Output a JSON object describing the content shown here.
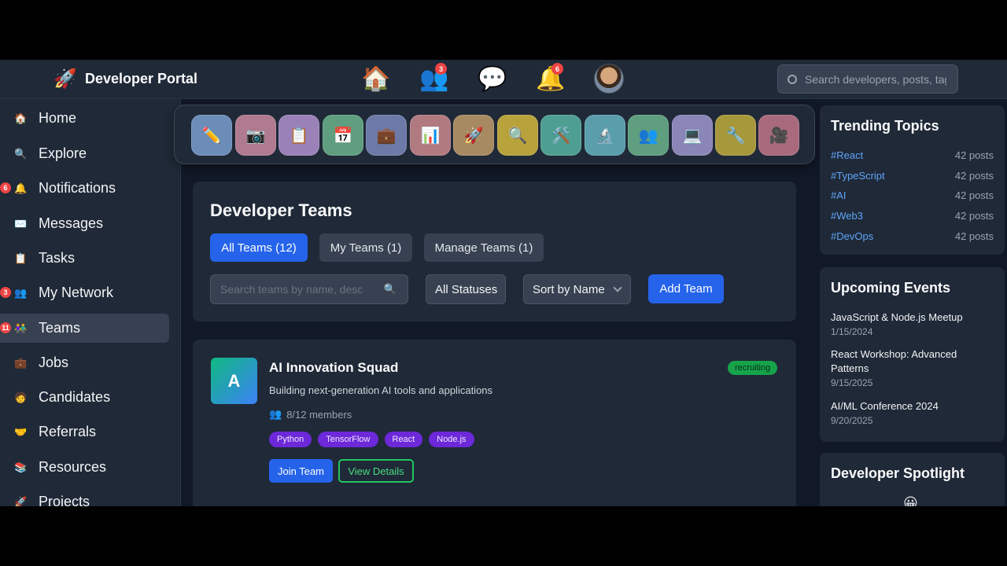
{
  "brand": {
    "name": "Developer Portal",
    "logo_icon": "🚀"
  },
  "topnav": {
    "icons": [
      {
        "name": "home-icon",
        "glyph": "🏠",
        "badge": ""
      },
      {
        "name": "network-icon",
        "glyph": "👥",
        "badge": "3"
      },
      {
        "name": "messages-icon",
        "glyph": "💬",
        "badge": ""
      },
      {
        "name": "notifications-icon",
        "glyph": "🔔",
        "badge": "6"
      }
    ],
    "search_placeholder": "Search developers, posts, tags..."
  },
  "sidebar": {
    "items": [
      {
        "label": "Home",
        "icon": "🏠",
        "badge": ""
      },
      {
        "label": "Explore",
        "icon": "🔍",
        "badge": ""
      },
      {
        "label": "Notifications",
        "icon": "🔔",
        "badge": "6"
      },
      {
        "label": "Messages",
        "icon": "✉️",
        "badge": ""
      },
      {
        "label": "Tasks",
        "icon": "📋",
        "badge": ""
      },
      {
        "label": "My Network",
        "icon": "👥",
        "badge": "3"
      },
      {
        "label": "Teams",
        "icon": "👫",
        "badge": "11"
      },
      {
        "label": "Jobs",
        "icon": "💼",
        "badge": ""
      },
      {
        "label": "Candidates",
        "icon": "🧑",
        "badge": ""
      },
      {
        "label": "Referrals",
        "icon": "🤝",
        "badge": ""
      },
      {
        "label": "Resources",
        "icon": "📚",
        "badge": ""
      },
      {
        "label": "Projects",
        "icon": "🚀",
        "badge": ""
      }
    ],
    "active_index": 6
  },
  "quickbar": [
    {
      "icon": "✏️",
      "color": "#6b8db8"
    },
    {
      "icon": "📷",
      "color": "#b07a8f"
    },
    {
      "icon": "📋",
      "color": "#9a82b8"
    },
    {
      "icon": "📅",
      "color": "#5f9e7f"
    },
    {
      "icon": "💼",
      "color": "#6d7aa8"
    },
    {
      "icon": "📊",
      "color": "#b07a80"
    },
    {
      "icon": "🚀",
      "color": "#a88a62"
    },
    {
      "icon": "🔍",
      "color": "#b8a23c"
    },
    {
      "icon": "🛠️",
      "color": "#4f9e92"
    },
    {
      "icon": "🔬",
      "color": "#5a9eac"
    },
    {
      "icon": "👥",
      "color": "#5f9e7f"
    },
    {
      "icon": "💻",
      "color": "#8a86b8"
    },
    {
      "icon": "🔧",
      "color": "#a8983c"
    },
    {
      "icon": "🎥",
      "color": "#a86a7c"
    }
  ],
  "teams": {
    "title": "Developer Teams",
    "tabs": [
      "All Teams (12)",
      "My Teams (1)",
      "Manage Teams (1)"
    ],
    "search_placeholder": "Search teams by name, description...",
    "status_filter": "All Statuses",
    "sort": "Sort by Name",
    "add_label": "Add Team"
  },
  "team_card": {
    "initial": "A",
    "name": "AI Innovation Squad",
    "description": "Building next-generation AI tools and applications",
    "members": "8/12 members",
    "status": "recruiting",
    "tags": [
      "Python",
      "TensorFlow",
      "React",
      "Node.js"
    ],
    "join_label": "Join Team",
    "details_label": "View Details"
  },
  "trending": {
    "title": "Trending Topics",
    "topics": [
      {
        "tag": "#React",
        "count": "42 posts"
      },
      {
        "tag": "#TypeScript",
        "count": "42 posts"
      },
      {
        "tag": "#AI",
        "count": "42 posts"
      },
      {
        "tag": "#Web3",
        "count": "42 posts"
      },
      {
        "tag": "#DevOps",
        "count": "42 posts"
      }
    ]
  },
  "events": {
    "title": "Upcoming Events",
    "items": [
      {
        "title": "JavaScript & Node.js Meetup",
        "date": "1/15/2024"
      },
      {
        "title": "React Workshop: Advanced Patterns",
        "date": "9/15/2025"
      },
      {
        "title": "AI/ML Conference 2024",
        "date": "9/20/2025"
      }
    ]
  },
  "spotlight": {
    "title": "Developer Spotlight",
    "icon": "😀"
  }
}
